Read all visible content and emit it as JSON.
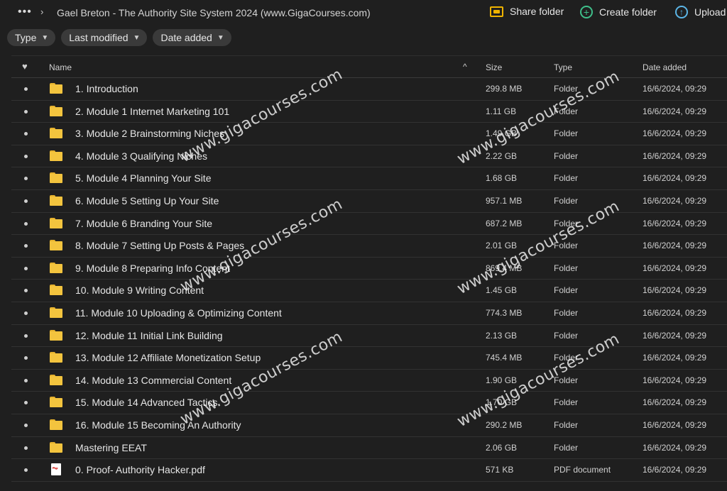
{
  "breadcrumb": {
    "more_label": "•••",
    "separator": "›",
    "current": "Gael Breton - The Authority Site System 2024 (www.GigaCourses.com)"
  },
  "actions": {
    "share_folder": "Share folder",
    "create_folder": "Create folder",
    "upload": "Upload"
  },
  "filters": {
    "type": "Type",
    "last_modified": "Last modified",
    "date_added": "Date added"
  },
  "columns": {
    "name": "Name",
    "size": "Size",
    "type": "Type",
    "date_added": "Date added",
    "sort_indicator": "^"
  },
  "rows": [
    {
      "name": "1. Introduction",
      "size": "299.8 MB",
      "type": "Folder",
      "date": "16/6/2024, 09:29",
      "icon": "folder-icon"
    },
    {
      "name": "2. Module 1 Internet Marketing 101",
      "size": "1.11 GB",
      "type": "Folder",
      "date": "16/6/2024, 09:29",
      "icon": "folder-icon"
    },
    {
      "name": "3. Module 2 Brainstorming Niches",
      "size": "1.49 GB",
      "type": "Folder",
      "date": "16/6/2024, 09:29",
      "icon": "folder-icon"
    },
    {
      "name": "4. Module 3 Qualifying Niches",
      "size": "2.22 GB",
      "type": "Folder",
      "date": "16/6/2024, 09:29",
      "icon": "folder-icon"
    },
    {
      "name": "5. Module 4 Planning Your Site",
      "size": "1.68 GB",
      "type": "Folder",
      "date": "16/6/2024, 09:29",
      "icon": "folder-icon"
    },
    {
      "name": "6. Module 5 Setting Up Your Site",
      "size": "957.1 MB",
      "type": "Folder",
      "date": "16/6/2024, 09:29",
      "icon": "folder-icon"
    },
    {
      "name": "7. Module 6 Branding Your Site",
      "size": "687.2 MB",
      "type": "Folder",
      "date": "16/6/2024, 09:29",
      "icon": "folder-icon"
    },
    {
      "name": "8. Module 7 Setting Up Posts & Pages",
      "size": "2.01 GB",
      "type": "Folder",
      "date": "16/6/2024, 09:29",
      "icon": "folder-icon"
    },
    {
      "name": "9. Module 8 Preparing Info Content",
      "size": "869.4 MB",
      "type": "Folder",
      "date": "16/6/2024, 09:29",
      "icon": "folder-icon"
    },
    {
      "name": "10. Module 9 Writing Content",
      "size": "1.45 GB",
      "type": "Folder",
      "date": "16/6/2024, 09:29",
      "icon": "folder-icon"
    },
    {
      "name": "11. Module 10 Uploading & Optimizing Content",
      "size": "774.3 MB",
      "type": "Folder",
      "date": "16/6/2024, 09:29",
      "icon": "folder-icon"
    },
    {
      "name": "12. Module 11 Initial Link Building",
      "size": "2.13 GB",
      "type": "Folder",
      "date": "16/6/2024, 09:29",
      "icon": "folder-icon"
    },
    {
      "name": "13. Module 12 Affiliate Monetization Setup",
      "size": "745.4 MB",
      "type": "Folder",
      "date": "16/6/2024, 09:29",
      "icon": "folder-icon"
    },
    {
      "name": "14. Module 13 Commercial Content",
      "size": "1.90 GB",
      "type": "Folder",
      "date": "16/6/2024, 09:29",
      "icon": "folder-icon"
    },
    {
      "name": "15. Module 14 Advanced Tactics",
      "size": "1.70 GB",
      "type": "Folder",
      "date": "16/6/2024, 09:29",
      "icon": "folder-icon"
    },
    {
      "name": "16. Module 15 Becoming An Authority",
      "size": "290.2 MB",
      "type": "Folder",
      "date": "16/6/2024, 09:29",
      "icon": "folder-icon"
    },
    {
      "name": "Mastering EEAT",
      "size": "2.06 GB",
      "type": "Folder",
      "date": "16/6/2024, 09:29",
      "icon": "folder-icon"
    },
    {
      "name": "0. Proof- Authority Hacker.pdf",
      "size": "571 KB",
      "type": "PDF document",
      "date": "16/6/2024, 09:29",
      "icon": "pdf-icon"
    }
  ],
  "watermark": "www.gigacourses.com",
  "colors": {
    "background": "#1f1f1f",
    "folder": "#f3c43e",
    "share_icon": "#f0b400",
    "create_icon": "#3fbf8a",
    "upload_icon": "#5bb5e6"
  }
}
